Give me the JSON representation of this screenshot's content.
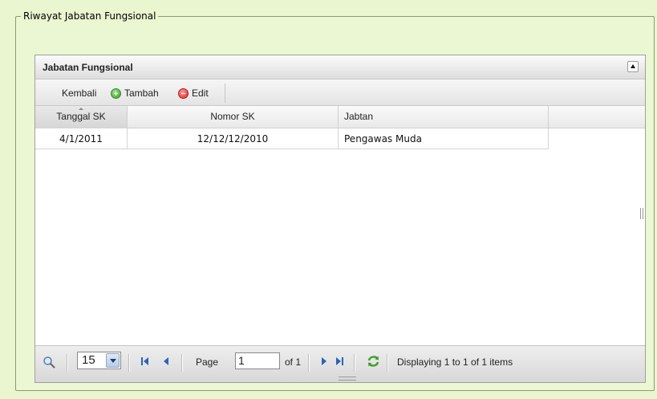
{
  "fieldset": {
    "legend": "Riwayat Jabatan Fungsional"
  },
  "panel": {
    "title": "Jabatan Fungsional",
    "toolbar": {
      "back_label": "Kembali",
      "add_label": "Tambah",
      "edit_label": "Edit"
    },
    "columns": [
      "Tanggal SK",
      "Nomor SK",
      "Jabtan"
    ],
    "rows": [
      {
        "tanggal_sk": "4/1/2011",
        "nomor_sk": "12/12/12/2010",
        "jabatan": "Pengawas Muda"
      }
    ]
  },
  "pager": {
    "page_size": "15",
    "page_label": "Page",
    "page_value": "1",
    "of_label": "of 1",
    "status": "Displaying 1 to 1 of 1 items"
  },
  "colors": {
    "background": "#eaf6d0",
    "panel_border": "#a0a0a0",
    "add_icon": "#3c9a2e",
    "edit_icon": "#d8262a",
    "select_arrow": "#1e3e77"
  },
  "icons": {
    "search": "magnifier-icon",
    "first": "first-page-icon",
    "prev": "prev-page-icon",
    "next": "next-page-icon",
    "last": "last-page-icon",
    "refresh": "refresh-icon",
    "add": "add-circle-icon",
    "edit": "remove-circle-icon",
    "collapse": "collapse-up-icon"
  }
}
